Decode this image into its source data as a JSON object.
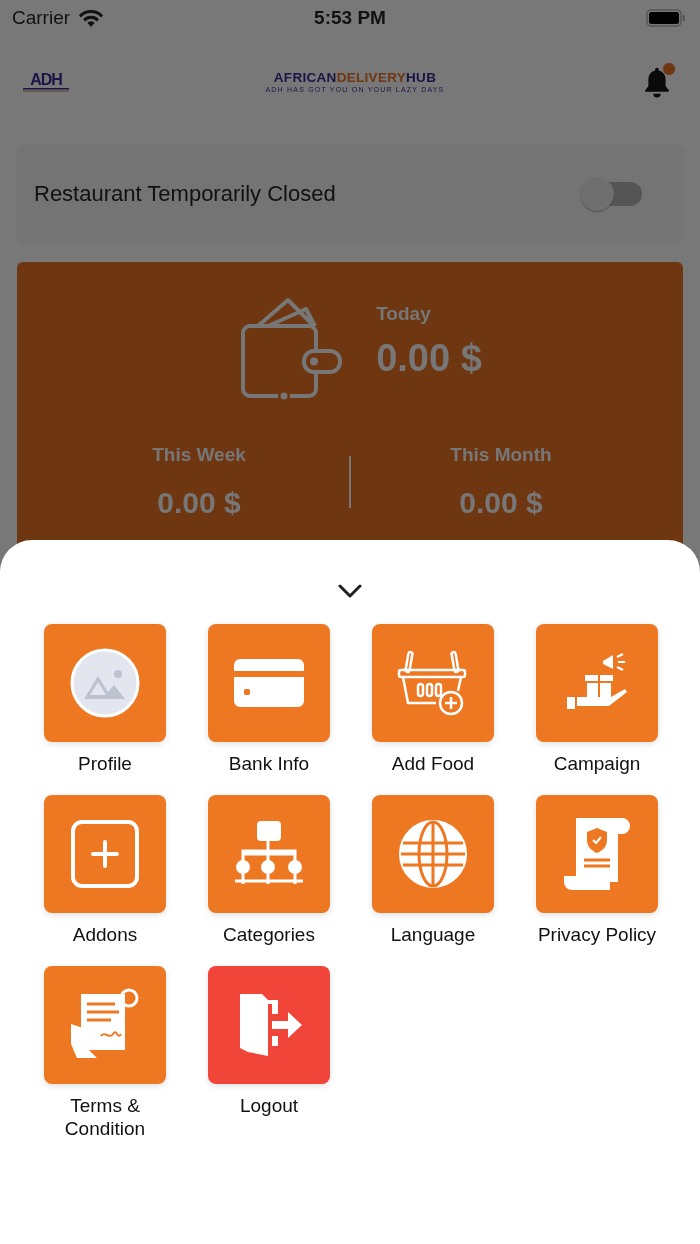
{
  "status_bar": {
    "carrier": "Carrier",
    "time": "5:53 PM"
  },
  "header": {
    "logo_mark": "ADH",
    "brand": [
      "AFRICAN",
      "DELIVERY",
      "HUB"
    ],
    "tagline": "ADH HAS GOT YOU ON YOUR LAZY DAYS",
    "notification": {
      "unread": true
    }
  },
  "closed_toggle": {
    "label": "Restaurant Temporarily Closed",
    "on": false
  },
  "earnings": {
    "today": {
      "label": "Today",
      "amount": "0.00 $"
    },
    "periods": [
      {
        "label": "This Week",
        "amount": "0.00 $"
      },
      {
        "label": "This Month",
        "amount": "0.00 $"
      }
    ]
  },
  "menu": [
    {
      "label": "Profile",
      "kind": "profile",
      "color": "#ee7722"
    },
    {
      "label": "Bank Info",
      "kind": "card",
      "color": "#ee7722"
    },
    {
      "label": "Add Food",
      "kind": "basket",
      "color": "#ee7722"
    },
    {
      "label": "Campaign",
      "kind": "campaign",
      "color": "#ee7722"
    },
    {
      "label": "Addons",
      "kind": "addons",
      "color": "#ee7722"
    },
    {
      "label": "Categories",
      "kind": "categories",
      "color": "#ee7722"
    },
    {
      "label": "Language",
      "kind": "language",
      "color": "#ee7722"
    },
    {
      "label": "Privacy Policy",
      "kind": "privacy",
      "color": "#ee7722"
    },
    {
      "label": "Terms & Condition",
      "kind": "terms",
      "color": "#ee7722"
    },
    {
      "label": "Logout",
      "kind": "logout",
      "color": "#f2453a"
    }
  ]
}
